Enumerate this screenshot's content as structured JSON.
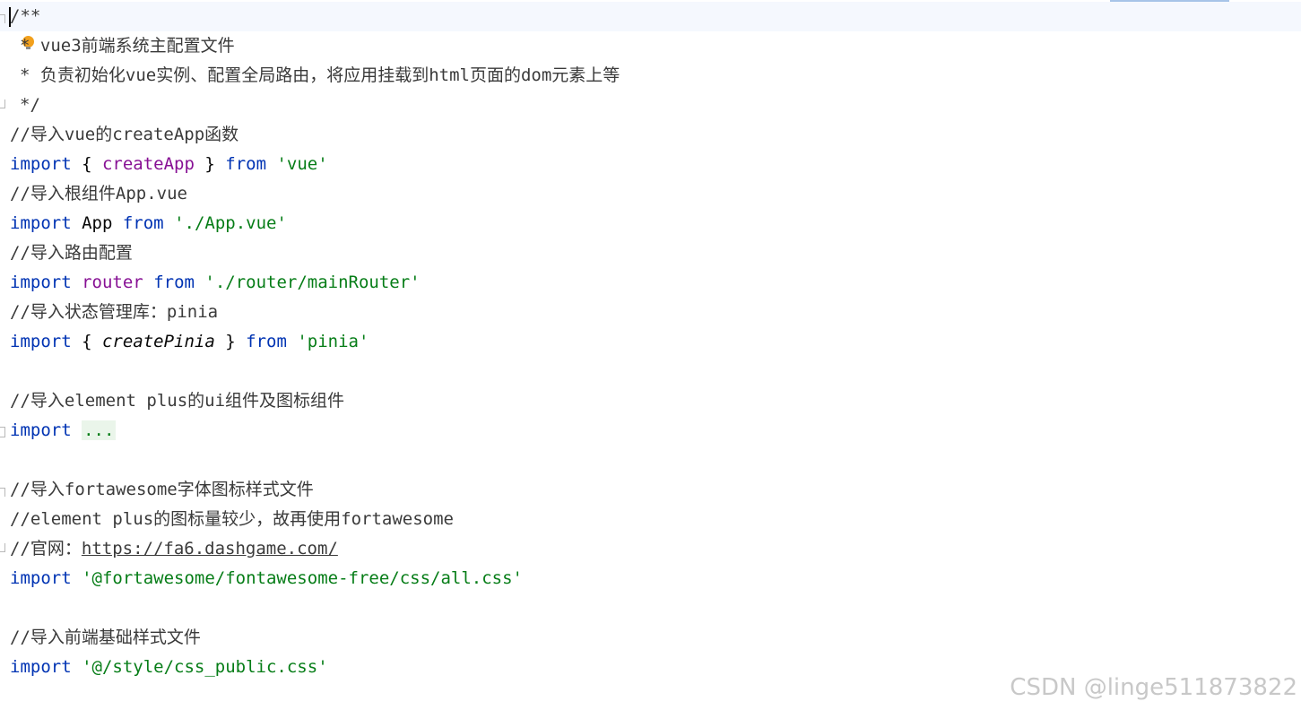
{
  "code": {
    "doc_open": "/**",
    "doc_star": "* ",
    "doc_line1": "vue3前端系统主配置文件",
    "doc_line2": "* 负责初始化vue实例、配置全局路由，将应用挂载到html页面的dom元素上等",
    "doc_close": "*/",
    "c_vue": "//导入vue的createApp函数",
    "kw_import": "import",
    "punc_open": " { ",
    "punc_close": " } ",
    "kw_from": "from",
    "id_createApp": "createApp",
    "str_vue": "'vue'",
    "c_app": "//导入根组件App.vue",
    "id_App": " App ",
    "str_app": "'./App.vue'",
    "c_router": "//导入路由配置",
    "id_router": "router",
    "str_router": "'./router/mainRouter'",
    "c_pinia": "//导入状态管理库：pinia",
    "id_createPinia": "createPinia",
    "str_pinia": "'pinia'",
    "c_element": "//导入element plus的ui组件及图标组件",
    "folded": "...",
    "c_fa1": "//导入fortawesome字体图标样式文件",
    "c_fa2": "//element plus的图标量较少，故再使用fortawesome",
    "c_fa3_prefix": "//官网：",
    "c_fa3_link": "https://fa6.dashgame.com/",
    "str_fa": "'@fortawesome/fontawesome-free/css/all.css'",
    "c_style": "//导入前端基础样式文件",
    "str_style": "'@/style/css_public.css'"
  },
  "watermark": "CSDN @linge511873822",
  "colors": {
    "keyword": "#0033b3",
    "identifier": "#871094",
    "string": "#067d17",
    "comment": "#3a3a3a",
    "current_line": "#f5f8fe"
  },
  "icons": [
    "fold-marker-icon",
    "lightbulb-icon"
  ]
}
